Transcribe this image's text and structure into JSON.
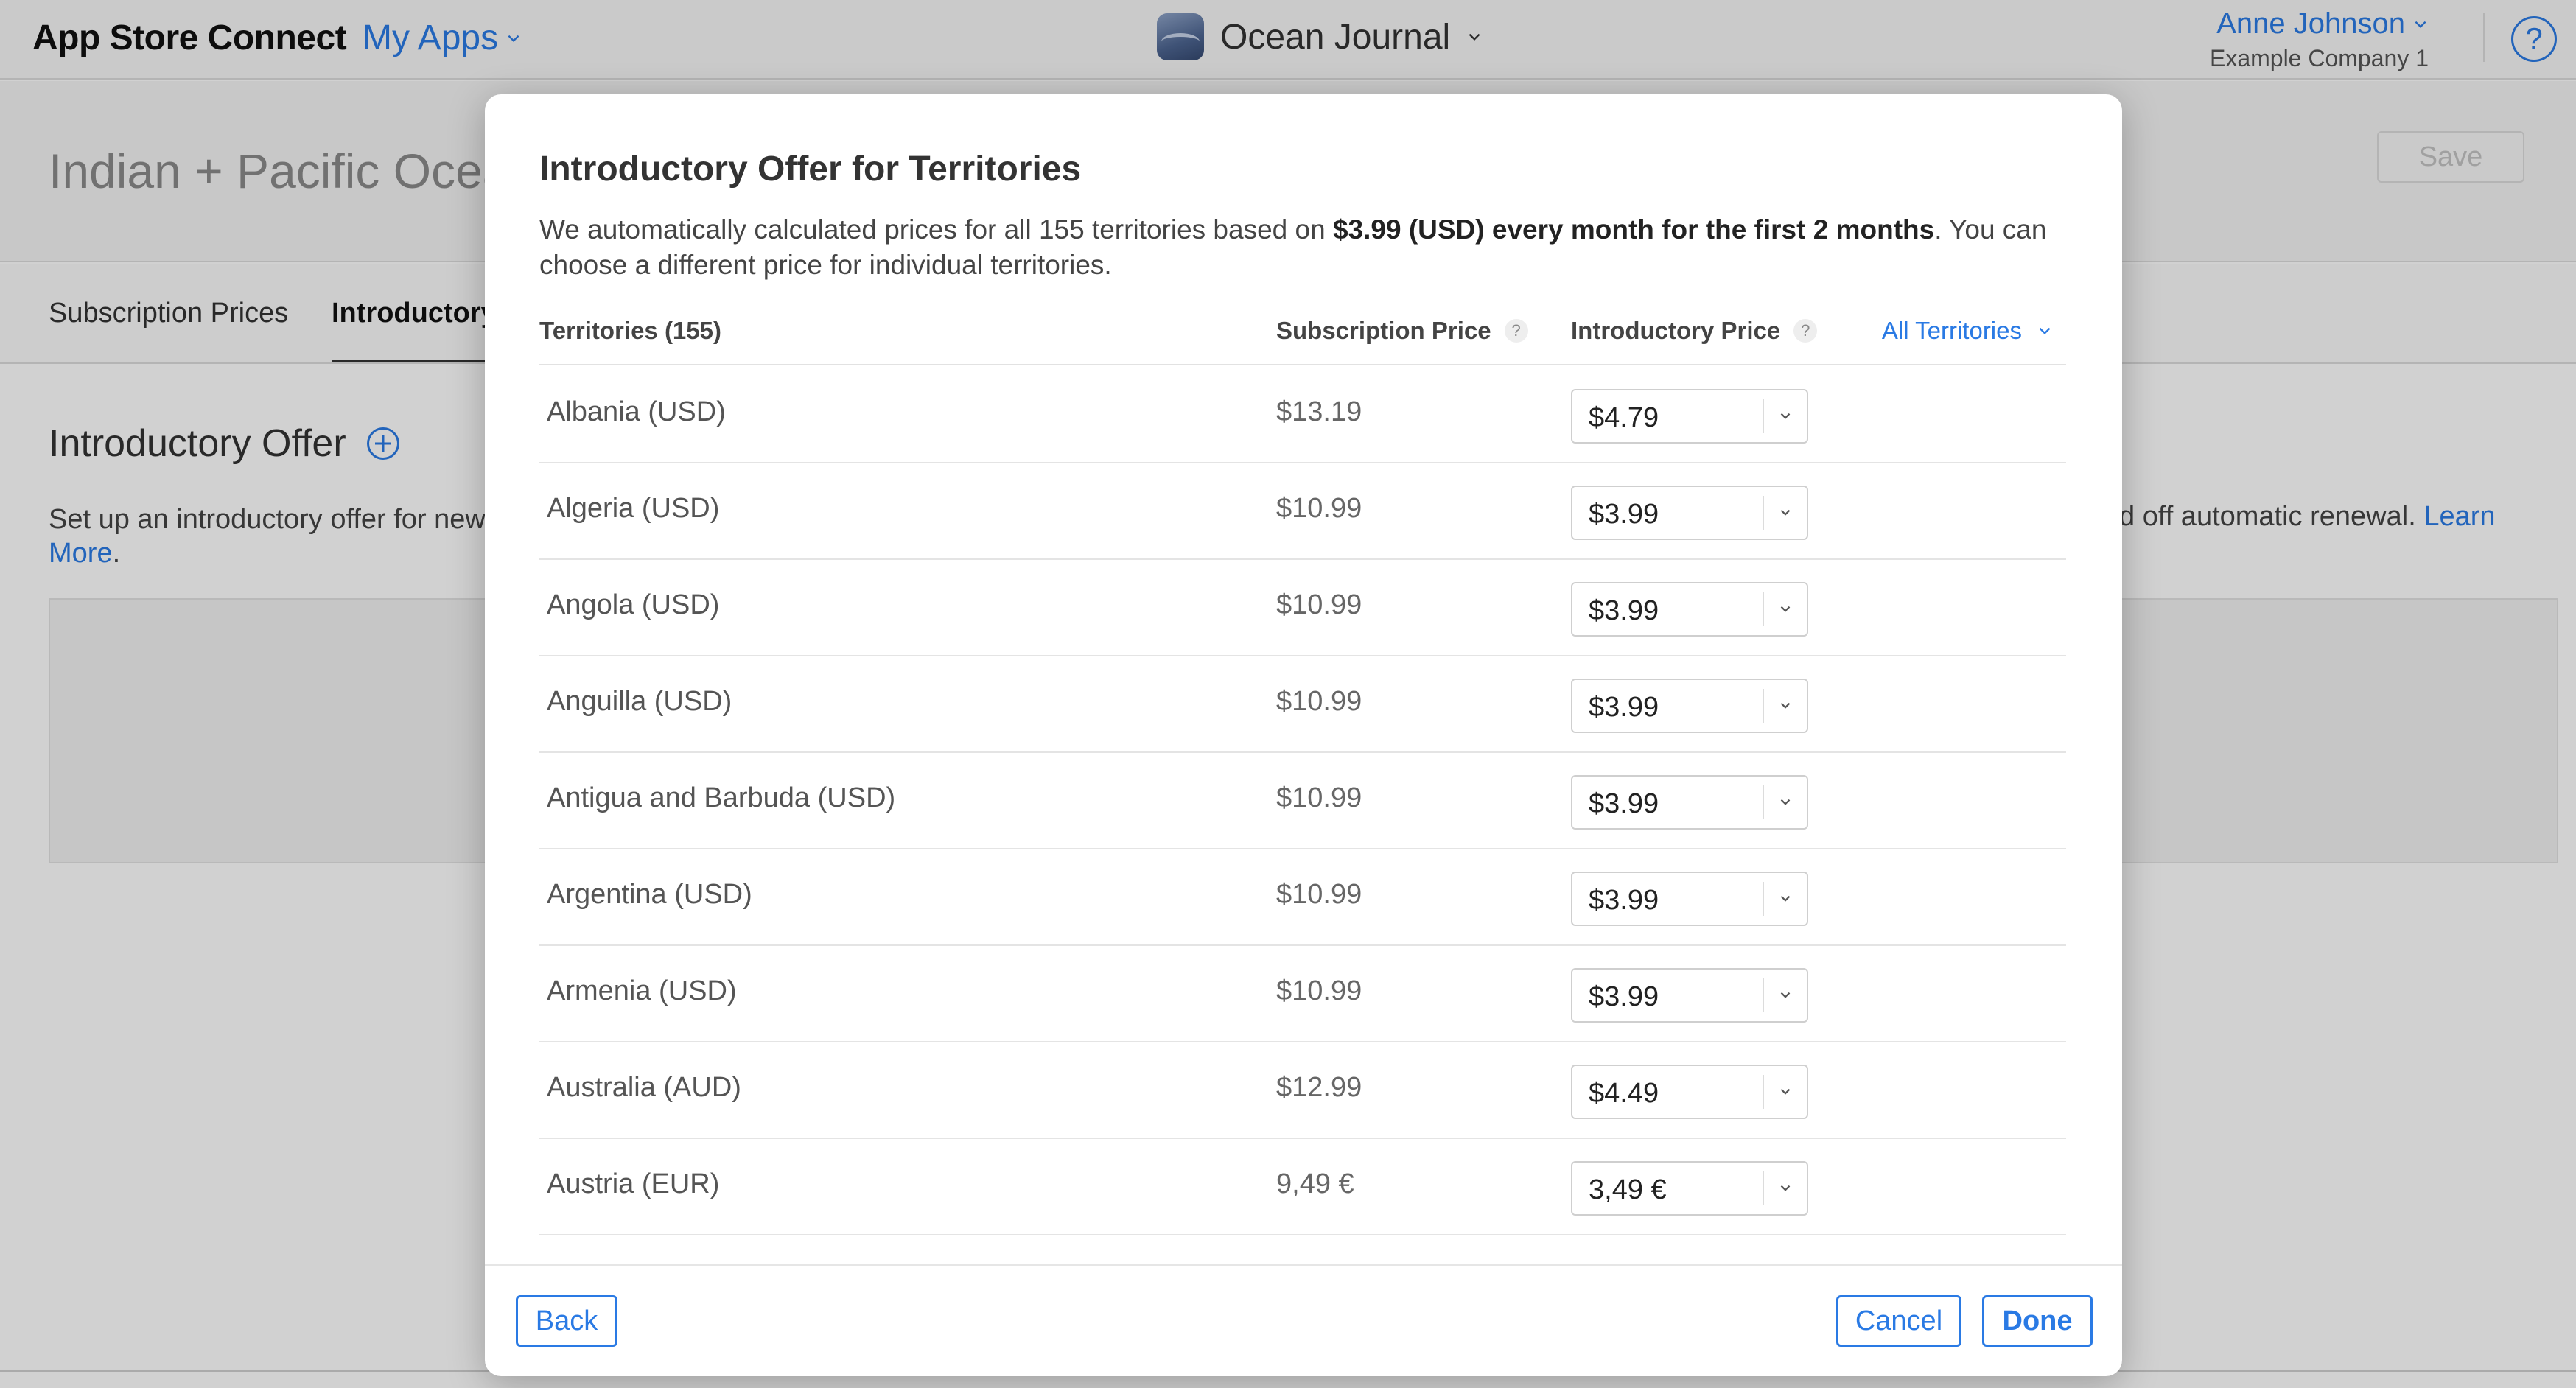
{
  "topbar": {
    "brand": "App Store Connect",
    "my_apps": "My Apps",
    "app_name": "Ocean Journal",
    "user_name": "Anne Johnson",
    "company": "Example Company 1",
    "help": "?"
  },
  "page": {
    "title": "Indian + Pacific Ocea",
    "save_label": "Save",
    "tabs": [
      "Subscription Prices",
      "Introductory"
    ],
    "section_title": "Introductory Offer",
    "section_desc": "Set up an introductory offer for new",
    "section_desc_right": "d off automatic renewal.",
    "learn_link": "Learn",
    "more_link": "More",
    "period": "."
  },
  "modal": {
    "title": "Introductory Offer for Territories",
    "desc_prefix": "We automatically calculated prices for all 155 territories based on ",
    "desc_bold": "$3.99 (USD) every month for the first 2 months",
    "desc_suffix": ". You can choose a different price for individual territories.",
    "columns": {
      "territories": "Territories (155)",
      "subscription_price": "Subscription Price",
      "introductory_price": "Introductory Price",
      "help": "?"
    },
    "filter_label": "All Territories",
    "rows": [
      {
        "territory": "Albania (USD)",
        "subscription": "$13.19",
        "intro": "$4.79"
      },
      {
        "territory": "Algeria (USD)",
        "subscription": "$10.99",
        "intro": "$3.99"
      },
      {
        "territory": "Angola (USD)",
        "subscription": "$10.99",
        "intro": "$3.99"
      },
      {
        "territory": "Anguilla (USD)",
        "subscription": "$10.99",
        "intro": "$3.99"
      },
      {
        "territory": "Antigua and Barbuda (USD)",
        "subscription": "$10.99",
        "intro": "$3.99"
      },
      {
        "territory": "Argentina (USD)",
        "subscription": "$10.99",
        "intro": "$3.99"
      },
      {
        "territory": "Armenia (USD)",
        "subscription": "$10.99",
        "intro": "$3.99"
      },
      {
        "territory": "Australia (AUD)",
        "subscription": "$12.99",
        "intro": "$4.49"
      },
      {
        "territory": "Austria (EUR)",
        "subscription": "9,49 €",
        "intro": "3,49 €"
      }
    ],
    "buttons": {
      "back": "Back",
      "cancel": "Cancel",
      "done": "Done"
    }
  },
  "colors": {
    "accent": "#2a7ae4",
    "text": "#1d1d1f",
    "overlay": "#00000030"
  }
}
